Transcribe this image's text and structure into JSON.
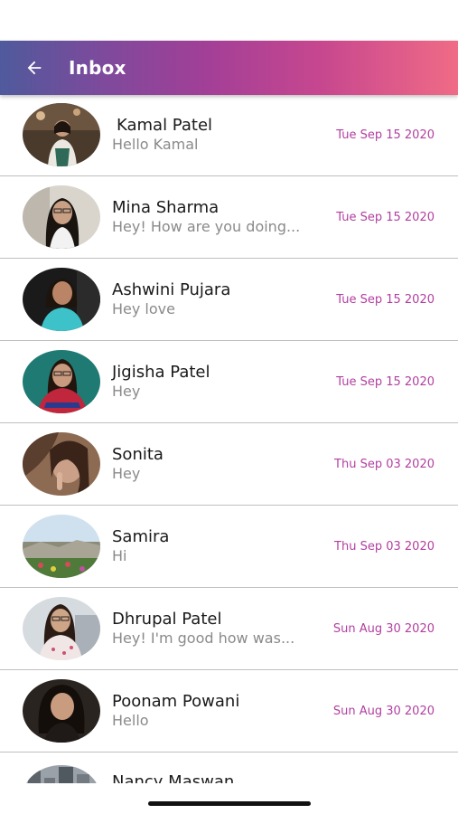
{
  "header": {
    "back_icon": "arrow-left-icon",
    "title": "Inbox",
    "gradient_start": "#4f5a9c",
    "gradient_end": "#f06b86"
  },
  "accent_date_color": "#b23fa0",
  "conversations": [
    {
      "name": "Kamal Patel",
      "preview": "Hello Kamal",
      "date": "Tue Sep 15 2020"
    },
    {
      "name": "Mina Sharma",
      "preview": "Hey! How are you doing...",
      "date": "Tue Sep 15 2020"
    },
    {
      "name": "Ashwini Pujara",
      "preview": "Hey love",
      "date": "Tue Sep 15 2020"
    },
    {
      "name": "Jigisha Patel",
      "preview": "Hey",
      "date": "Tue Sep 15 2020"
    },
    {
      "name": "Sonita",
      "preview": "Hey",
      "date": "Thu Sep 03 2020"
    },
    {
      "name": "Samira",
      "preview": "Hi",
      "date": "Thu Sep 03 2020"
    },
    {
      "name": "Dhrupal Patel",
      "preview": "Hey! I'm good how was...",
      "date": "Sun Aug 30 2020"
    },
    {
      "name": "Poonam Powani",
      "preview": "Hello",
      "date": "Sun Aug 30 2020"
    },
    {
      "name": "Nancy Maswan",
      "preview": "",
      "date": ""
    }
  ]
}
